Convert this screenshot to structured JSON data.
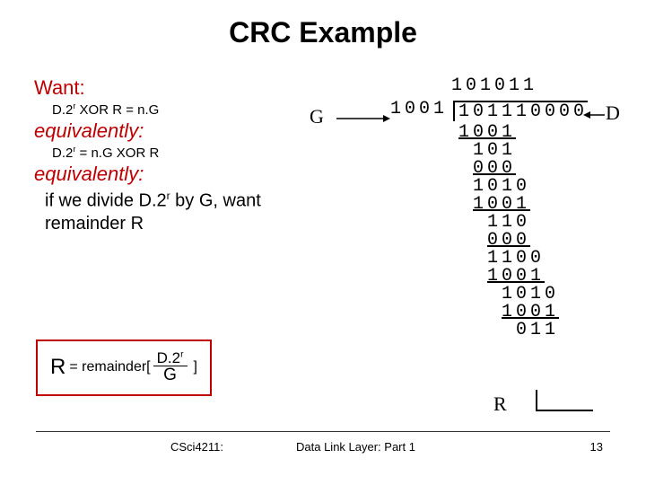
{
  "title": "CRC Example",
  "left": {
    "want": "Want:",
    "eq1_a": "D",
    "eq1_b": ".",
    "eq1_c": "2",
    "eq1_r": "r",
    "eq1_d": " XOR R = n.G",
    "equiv": "equivalently:",
    "eq2_a": "D",
    "eq2_b": ".",
    "eq2_c": "2",
    "eq2_r": "r",
    "eq2_d": " = n.G XOR R",
    "body_a": "if we divide D",
    "body_dot": ".",
    "body_2": "2",
    "body_r": "r",
    "body_b": " by G, want remainder R",
    "box_R": "R",
    "box_eq": " = remainder[",
    "box_close": "]",
    "frac_top_a": "D",
    "frac_top_dot": ".",
    "frac_top_2": "2",
    "frac_top_r": "r",
    "frac_bot": "G"
  },
  "division": {
    "g_label": "G",
    "d_label": "D",
    "r_label": "R",
    "quotient": "101011",
    "divisor": "1001",
    "dividend": "101110000",
    "steps": [
      " 1001",
      "  101",
      "  000",
      "  1010",
      "  1001",
      "   110",
      "   000",
      "   1100",
      "   1001",
      "    1010",
      "    1001",
      "     011"
    ],
    "underline_idx": [
      0,
      2,
      4,
      6,
      8,
      10
    ]
  },
  "footer": {
    "left": "CSci4211:",
    "center": "Data Link Layer: Part 1",
    "right": "13"
  }
}
